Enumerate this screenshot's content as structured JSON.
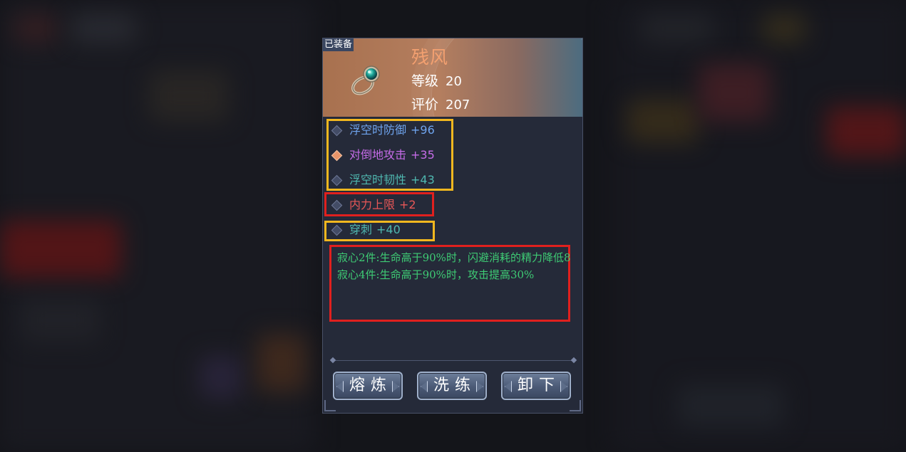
{
  "item": {
    "equipped_tag": "已装备",
    "icon": "ring-icon",
    "name": "残风",
    "level_label": "等级",
    "level_value": "20",
    "score_label": "评价",
    "score_value": "207"
  },
  "attributes": [
    {
      "name": "浮空时防御",
      "value": "+96",
      "color": "#6fa4ee",
      "marker": "blue"
    },
    {
      "name": "对倒地攻击",
      "value": "+35",
      "color": "#c66ce8",
      "marker": "orange"
    },
    {
      "name": "浮空时韧性",
      "value": "+43",
      "color": "#4fb8b0",
      "marker": "blue"
    },
    {
      "name": "内力上限",
      "value": "+2",
      "color": "#e85757",
      "marker": "blue"
    },
    {
      "name": "穿刺",
      "value": "+40",
      "color": "#4fb8b0",
      "marker": "blue"
    }
  ],
  "set_bonus": {
    "line1": "寂心2件:生命高于90%时，闪避消耗的精力降低8",
    "line2": "寂心4件:生命高于90%时，攻击提高30%",
    "color": "#3ecb74"
  },
  "buttons": {
    "smelt": "熔炼",
    "refine": "洗练",
    "unequip": "卸下"
  },
  "highlight_colors": {
    "yellow": "#f1b71f",
    "red": "#e0201e"
  }
}
